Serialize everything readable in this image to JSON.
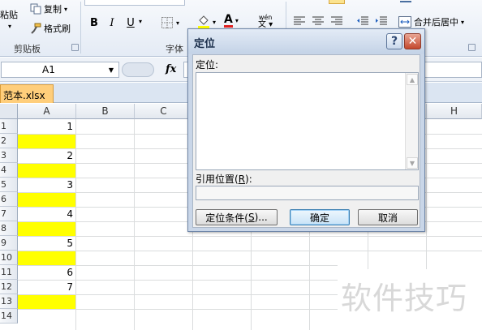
{
  "ribbon": {
    "paste_label": "粘贴",
    "copy_label": "复制",
    "format_painter_label": "格式刷",
    "clipboard_group": "剪贴板",
    "font_group": "字体",
    "bold_label": "B",
    "italic_label": "I",
    "underline_label": "U",
    "font_color_label": "A",
    "pinyin_label": "wén",
    "merge_center_label": "合并后居中"
  },
  "formula_bar": {
    "name_box": "A1",
    "fx_label": "fx"
  },
  "sheet": {
    "file_tab": "范本.xlsx",
    "columns": [
      "A",
      "B",
      "C",
      "H"
    ],
    "rows": [
      "1",
      "2",
      "3",
      "4",
      "5",
      "6",
      "7",
      "8",
      "9",
      "10",
      "11",
      "12",
      "13",
      "14"
    ],
    "cell_values": [
      "1",
      "",
      "2",
      "",
      "3",
      "",
      "4",
      "",
      "5",
      "",
      "6",
      "7",
      "",
      ""
    ],
    "highlight_color": "#ffff00"
  },
  "dialog": {
    "title": "定位",
    "help_label": "?",
    "close_label": "✕",
    "goto_label": "定位:",
    "reference_label": "引用位置(",
    "reference_key": "R",
    "reference_suffix": "):",
    "special_label": "定位条件(",
    "special_key": "S",
    "special_suffix": ")...",
    "ok_label": "确定",
    "cancel_label": "取消"
  },
  "watermark": "软件技巧"
}
